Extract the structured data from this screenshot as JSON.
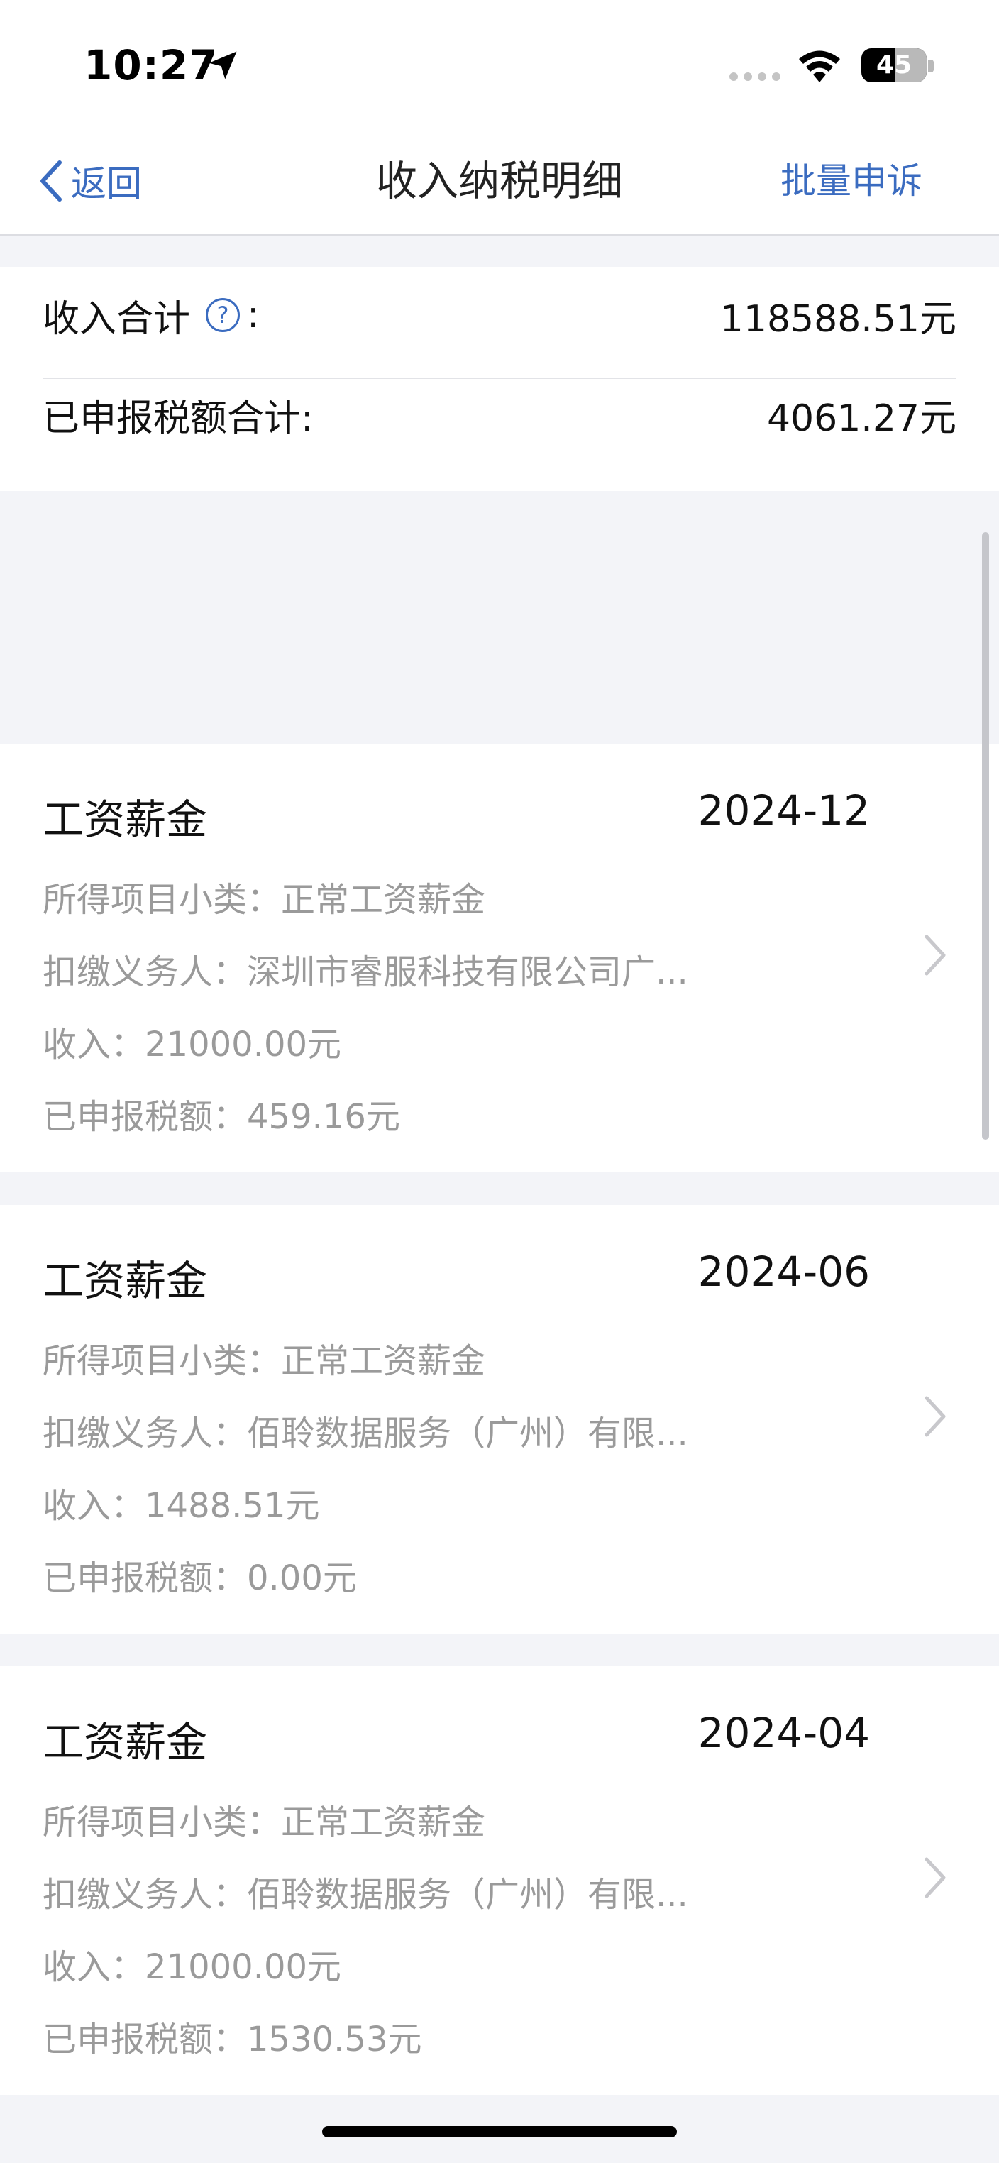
{
  "status_bar": {
    "time": "10:27",
    "battery": "45",
    "icons": [
      "location-arrow-icon",
      "signal-dots-icon",
      "wifi-icon",
      "battery-icon"
    ]
  },
  "nav": {
    "back_label": "返回",
    "title": "收入纳税明细",
    "batch_appeal": "批量申诉"
  },
  "summary": {
    "income_total_label": "收入合计",
    "help_glyph": "?",
    "colon": ":",
    "income_total_value": "118588.51元",
    "tax_total_label": "已申报税额合计:",
    "tax_total_value": "4061.27元"
  },
  "records": [
    {
      "type": "工资薪金",
      "period": "2024-12",
      "subcategory": "所得项目小类：正常工资薪金",
      "withholder": "扣缴义务人：深圳市睿服科技有限公司广...",
      "income": "收入：21000.00元",
      "tax": "已申报税额：459.16元"
    },
    {
      "type": "工资薪金",
      "period": "2024-06",
      "subcategory": "所得项目小类：正常工资薪金",
      "withholder": "扣缴义务人：佰聆数据服务（广州）有限...",
      "income": "收入：1488.51元",
      "tax": "已申报税额：0.00元"
    },
    {
      "type": "工资薪金",
      "period": "2024-04",
      "subcategory": "所得项目小类：正常工资薪金",
      "withholder": "扣缴义务人：佰聆数据服务（广州）有限...",
      "income": "收入：21000.00元",
      "tax": "已申报税额：1530.53元"
    }
  ],
  "colors": {
    "accent": "#3b6cc0",
    "secondary_text": "#9a9a9a",
    "page_background": "#f3f4f8"
  }
}
